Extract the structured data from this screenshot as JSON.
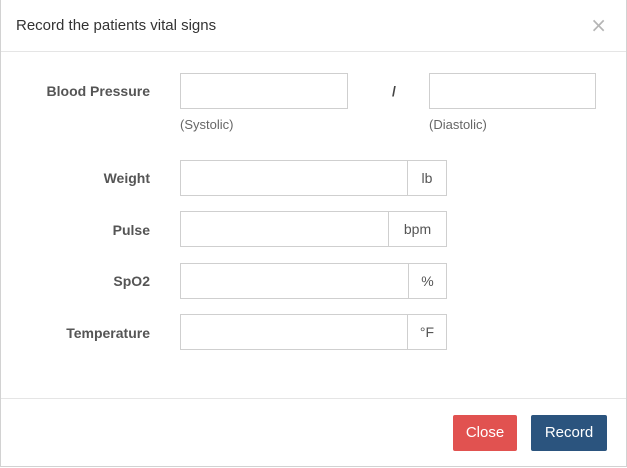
{
  "dialog": {
    "title": "Record the patients vital signs",
    "close_symbol": "×"
  },
  "form": {
    "blood_pressure": {
      "label": "Blood Pressure",
      "separator": "/",
      "systolic_hint": "(Systolic)",
      "diastolic_hint": "(Diastolic)",
      "systolic_value": "",
      "diastolic_value": ""
    },
    "weight": {
      "label": "Weight",
      "unit": "lb",
      "value": ""
    },
    "pulse": {
      "label": "Pulse",
      "unit": "bpm",
      "value": ""
    },
    "spo2": {
      "label": "SpO2",
      "unit": "%",
      "value": ""
    },
    "temperature": {
      "label": "Temperature",
      "unit": "°F",
      "value": ""
    }
  },
  "footer": {
    "close_label": "Close",
    "record_label": "Record"
  },
  "colors": {
    "close_button": "#e15250",
    "record_button": "#2b547e"
  }
}
